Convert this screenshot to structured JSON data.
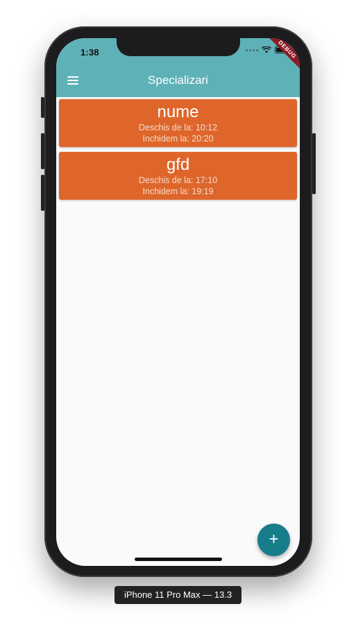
{
  "status_bar": {
    "time": "1:38"
  },
  "debug_banner": "DEBUG",
  "app_bar": {
    "title": "Specializari"
  },
  "cards": [
    {
      "name": "nume",
      "opens": "Deschis de la: 10:12",
      "closes": "Inchidem la: 20:20"
    },
    {
      "name": "gfd",
      "opens": "Deschis de la: 17:10",
      "closes": "Inchidem la: 19:19"
    }
  ],
  "fab": {
    "icon": "plus-icon",
    "label": "+"
  },
  "device_label": "iPhone 11 Pro Max — 13.3",
  "colors": {
    "app_bar": "#5fb1b8",
    "card": "#de662b",
    "fab": "#177d8a"
  }
}
